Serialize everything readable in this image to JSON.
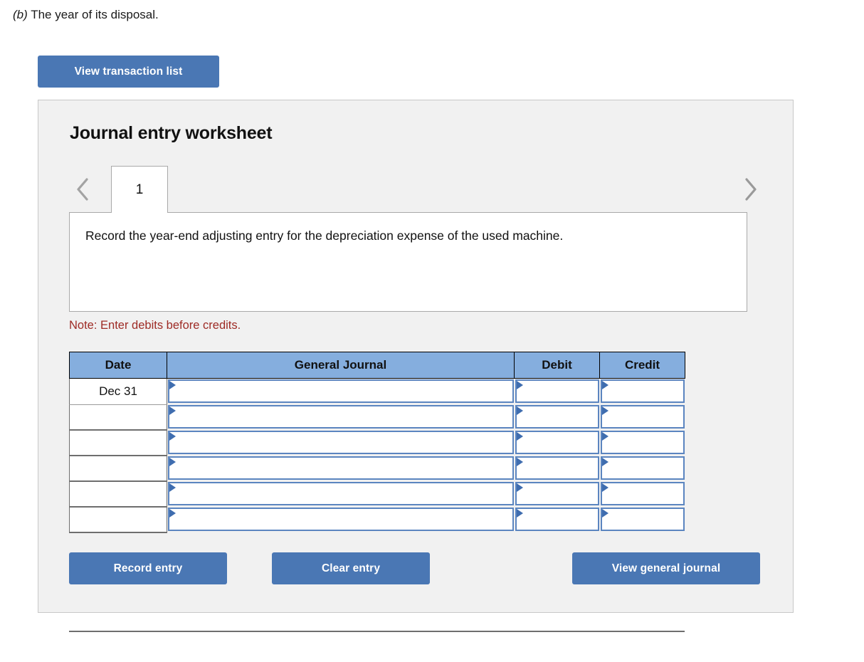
{
  "question": {
    "label": "(b)",
    "text": " The year of its disposal."
  },
  "top_actions": {
    "view_transaction_list": "View transaction list"
  },
  "worksheet": {
    "title": "Journal entry worksheet",
    "nav": {
      "prev_icon": "chevron-left-icon",
      "next_icon": "chevron-right-icon"
    },
    "tabs": [
      {
        "label": "1",
        "active": true
      }
    ],
    "instruction": "Record the year-end adjusting entry for the depreciation expense of the used machine.",
    "note": "Note: Enter debits before credits.",
    "table": {
      "headers": [
        "Date",
        "General Journal",
        "Debit",
        "Credit"
      ],
      "rows": [
        {
          "date": "Dec 31",
          "general_journal": "",
          "debit": "",
          "credit": ""
        },
        {
          "date": "",
          "general_journal": "",
          "debit": "",
          "credit": ""
        },
        {
          "date": "",
          "general_journal": "",
          "debit": "",
          "credit": ""
        },
        {
          "date": "",
          "general_journal": "",
          "debit": "",
          "credit": ""
        },
        {
          "date": "",
          "general_journal": "",
          "debit": "",
          "credit": ""
        },
        {
          "date": "",
          "general_journal": "",
          "debit": "",
          "credit": ""
        }
      ]
    },
    "footer_actions": {
      "record_entry": "Record entry",
      "clear_entry": "Clear entry",
      "view_general_journal": "View general journal"
    }
  },
  "colors": {
    "button_blue": "#4a77b4",
    "header_blue": "#85aede",
    "field_border_blue": "#5b85c0",
    "note_red": "#9e2b25",
    "panel_bg": "#f1f1f1"
  }
}
